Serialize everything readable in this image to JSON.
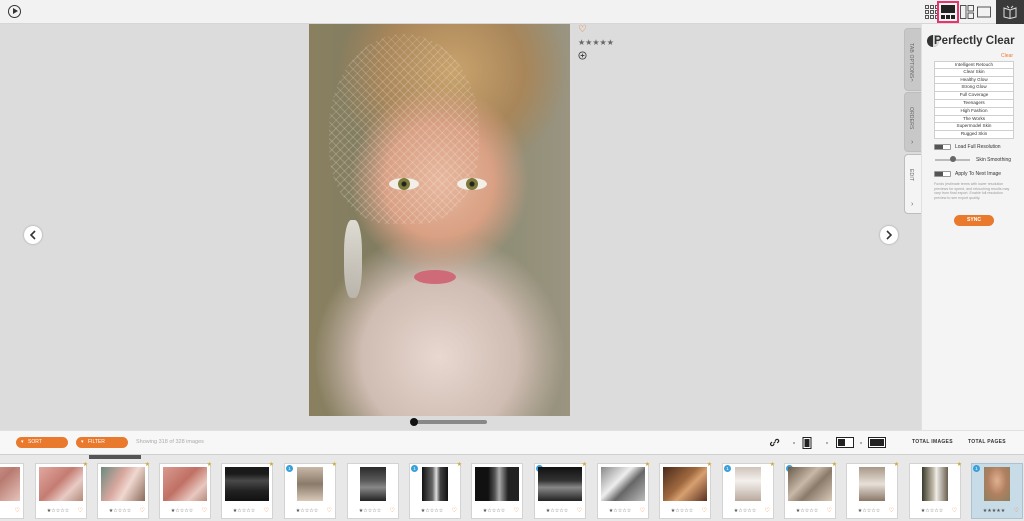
{
  "header": {
    "icons": [
      "play-icon",
      "grid-view-icon",
      "filmstrip-view-icon",
      "compare-view-icon",
      "single-view-icon",
      "book-icon"
    ],
    "highlight_color": "#e8336d"
  },
  "viewer": {
    "photo_stars": "★★★★★",
    "heart": "♡"
  },
  "side_tabs": {
    "tab_options": "TAB OPTIONS",
    "orders": "ORDERS",
    "edit": "EDIT"
  },
  "panel": {
    "title": "Perfectly Clear",
    "clear_label": "Clear",
    "presets": [
      "Intelligent Retouch",
      "Clear Skin",
      "Healthy Glow",
      "Strong Glow",
      "Full Coverage",
      "Teenagers",
      "High Fashion",
      "The Works",
      "Supermodel Skin",
      "Rugged Skin"
    ],
    "toggle_off": "OFF",
    "load_full_resolution": "Load Full Resolution",
    "skin_smoothing": "Skin Smoothing",
    "apply_to_next_image": "Apply To Next Image",
    "help_text": "Funds (estimate terms with lower resolution previews for speed, and retouching results may vary from final export. Enable full resolution preview to see export quality.",
    "sync_button": "SYNC",
    "accent_color": "#e9792c"
  },
  "toolbar": {
    "sort": "SORT",
    "filter": "FILTER",
    "showing": "Showing 318 of 328 images",
    "total_images": "TOTAL IMAGES",
    "total_pages": "TOTAL PAGES"
  },
  "filmstrip": {
    "thumb_stars": "★☆☆☆☆",
    "thumb_stars_selected": "★★★★★",
    "heart": "♡",
    "badge_number": "1"
  }
}
